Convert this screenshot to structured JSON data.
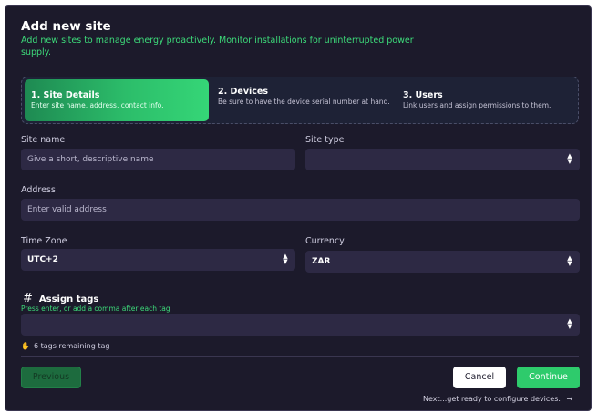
{
  "dialog": {
    "title": "Add new site",
    "subtitle": "Add new sites to manage energy proactively. Monitor installations for uninterrupted power supply."
  },
  "steps": [
    {
      "title": "1. Site Details",
      "description": "Enter site name, address, contact info.",
      "active": true
    },
    {
      "title": "2. Devices",
      "description": "Be sure to have the device serial number at hand.",
      "active": false
    },
    {
      "title": "3. Users",
      "description": "Link users and assign permissions to them.",
      "active": false
    }
  ],
  "form": {
    "site_name": {
      "label": "Site name",
      "placeholder": "Give a short, descriptive name",
      "value": ""
    },
    "site_type": {
      "label": "Site type",
      "value": ""
    },
    "address": {
      "label": "Address",
      "placeholder": "Enter valid address",
      "value": ""
    },
    "time_zone": {
      "label": "Time Zone",
      "value": "UTC+2"
    },
    "currency": {
      "label": "Currency",
      "value": "ZAR"
    },
    "tags": {
      "label": "Assign tags",
      "hint": "Press enter, or add a comma after each tag",
      "remaining": "6 tags remaining tag",
      "value": ""
    }
  },
  "footer": {
    "previous_label": "Previous",
    "cancel_label": "Cancel",
    "continue_label": "Continue",
    "next_hint": "Next...get ready to configure devices.",
    "next_arrow": "→"
  },
  "icons": {
    "hash": "#",
    "chevron_up": "▲",
    "chevron_down": "▼",
    "tag_hand": "✋"
  },
  "colors": {
    "background": "#1c1a2b",
    "accent": "#2ecb6c",
    "input": "#2d2944"
  }
}
